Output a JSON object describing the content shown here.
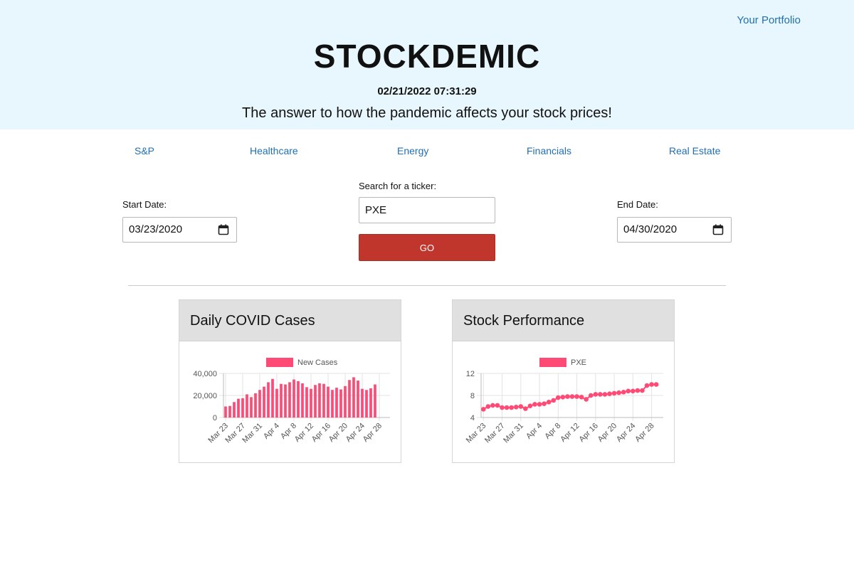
{
  "header": {
    "portfolio_link": "Your Portfolio",
    "title": "STOCKDEMIC",
    "datetime": "02/21/2022 07:31:29",
    "tagline": "The answer to how the pandemic affects your stock prices!"
  },
  "sectors": [
    "S&P",
    "Healthcare",
    "Energy",
    "Financials",
    "Real Estate"
  ],
  "search": {
    "start_label": "Start Date:",
    "start_value": "03/23/2020",
    "ticker_label": "Search for a ticker:",
    "ticker_value": "PXE",
    "go_label": "GO",
    "end_label": "End Date:",
    "end_value": "04/30/2020"
  },
  "cards": {
    "covid_title": "Daily COVID Cases",
    "stock_title": "Stock Performance"
  },
  "colors": {
    "accent": "#c0362c",
    "series": "#ff4a76",
    "header_bg": "#e8f7fe",
    "link": "#1f6fb2"
  },
  "chart_data": [
    {
      "type": "bar",
      "title": "",
      "legend": "top",
      "grid": true,
      "series": [
        {
          "name": "New Cases",
          "values": [
            10000,
            10500,
            14000,
            17000,
            17500,
            21000,
            18500,
            22000,
            25000,
            28000,
            32000,
            35000,
            26000,
            30500,
            30000,
            32000,
            34500,
            33000,
            31000,
            27500,
            26000,
            29500,
            31000,
            30500,
            28000,
            25000,
            27000,
            25500,
            28500,
            34000,
            36500,
            33500,
            26000,
            25000,
            26500,
            30000
          ]
        }
      ],
      "categories": [
        "Mar 23",
        "",
        "",
        "",
        "Mar 27",
        "",
        "",
        "",
        "Mar 31",
        "",
        "",
        "",
        "Apr 4",
        "",
        "",
        "",
        "Apr 8",
        "",
        "",
        "",
        "Apr 12",
        "",
        "",
        "",
        "Apr 16",
        "",
        "",
        "",
        "Apr 20",
        "",
        "",
        "",
        "Apr 24",
        "",
        "",
        "",
        "Apr 28",
        "",
        ""
      ],
      "y_ticks": [
        "0",
        "20,000",
        "40,000"
      ],
      "ylim": [
        0,
        40000
      ]
    },
    {
      "type": "line",
      "title": "",
      "legend": "top",
      "grid": true,
      "series": [
        {
          "name": "PXE",
          "values": [
            5.5,
            6.0,
            6.2,
            6.2,
            5.8,
            5.8,
            5.8,
            5.9,
            6.0,
            5.6,
            6.1,
            6.4,
            6.4,
            6.5,
            6.8,
            7.1,
            7.6,
            7.7,
            7.8,
            7.8,
            7.8,
            7.7,
            7.3,
            8.0,
            8.2,
            8.2,
            8.2,
            8.3,
            8.4,
            8.5,
            8.6,
            8.8,
            8.8,
            8.9,
            8.9,
            9.8,
            10.0,
            10.0
          ]
        }
      ],
      "categories": [
        "Mar 23",
        "",
        "",
        "",
        "Mar 27",
        "",
        "",
        "",
        "Mar 31",
        "",
        "",
        "",
        "Apr 4",
        "",
        "",
        "",
        "Apr 8",
        "",
        "",
        "",
        "Apr 12",
        "",
        "",
        "",
        "Apr 16",
        "",
        "",
        "",
        "Apr 20",
        "",
        "",
        "",
        "Apr 24",
        "",
        "",
        "",
        "Apr 28",
        "",
        ""
      ],
      "y_ticks": [
        "4",
        "8",
        "12"
      ],
      "ylim": [
        4,
        12
      ]
    }
  ]
}
